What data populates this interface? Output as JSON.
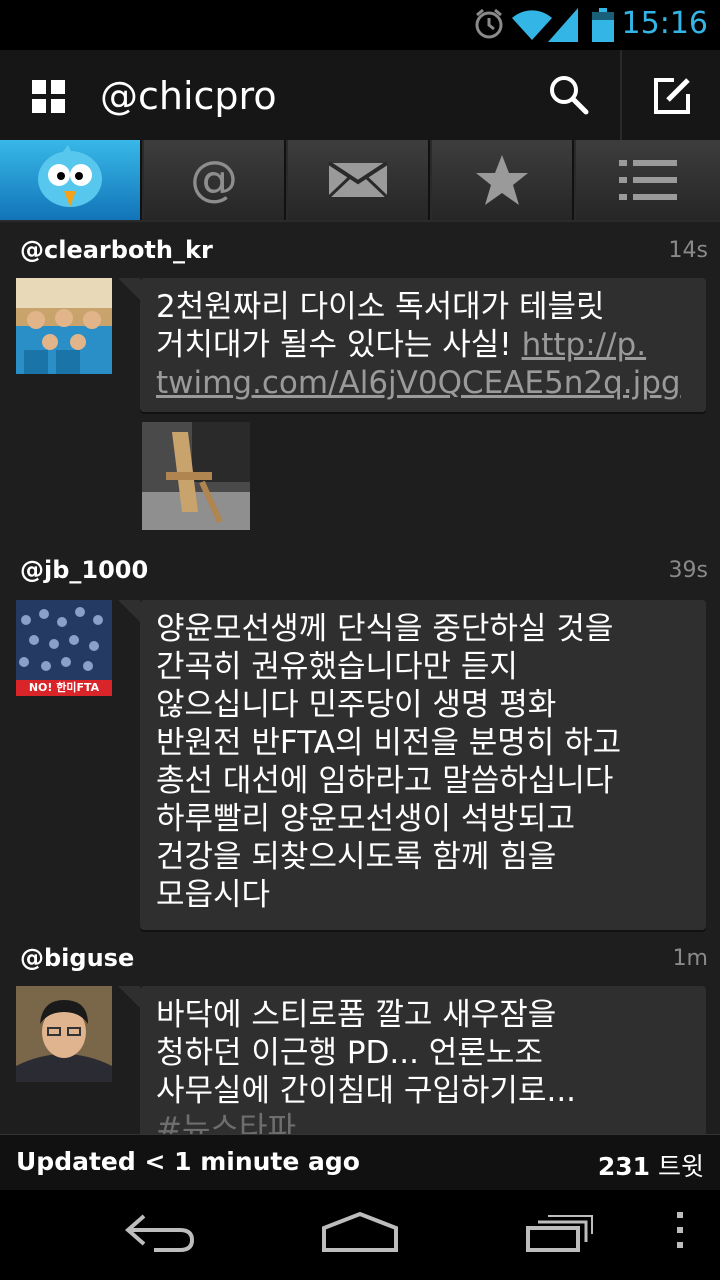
{
  "status_bar": {
    "time": "15:16",
    "icons": [
      "alarm-icon",
      "wifi-icon",
      "cell-signal-icon",
      "battery-icon"
    ],
    "accent_color": "#33b5e5"
  },
  "action_bar": {
    "title": "@chicpro",
    "icons": [
      "app-grid-icon",
      "search-icon",
      "compose-icon"
    ]
  },
  "tabs": [
    {
      "name": "timeline",
      "icon": "bird-icon",
      "active": true
    },
    {
      "name": "mentions",
      "icon": "at-icon",
      "active": false
    },
    {
      "name": "messages",
      "icon": "envelope-icon",
      "active": false
    },
    {
      "name": "favorites",
      "icon": "star-icon",
      "active": false
    },
    {
      "name": "lists",
      "icon": "list-icon",
      "active": false
    }
  ],
  "tweets": [
    {
      "handle": "@clearboth_kr",
      "age": "14s",
      "text_lines": [
        "2천원짜리 다이소 독서대가 테블릿",
        "거치대가 될수 있다는 사실! "
      ],
      "link": "http://p.",
      "link_lines": [
        "twimg.com/Al6jV0QCEAE5n2q.jpg"
      ],
      "has_image": true
    },
    {
      "handle": "@jb_1000",
      "age": "39s",
      "avatar_label": "NO! 한미FTA",
      "text_lines": [
        "양윤모선생께 단식을 중단하실 것을",
        "간곡히 권유했습니다만 듣지",
        "않으십니다 민주당이 생명 평화",
        "반원전 반FTA의 비전을 분명히 하고",
        "총선 대선에 임하라고 말씀하십니다",
        "하루빨리 양윤모선생이 석방되고",
        "건강을 되찾으시도록 함께 힘을",
        "모읍시다"
      ]
    },
    {
      "handle": "@biguse",
      "age": "1m",
      "text_lines": [
        "바닥에 스티로폼 깔고 새우잠을",
        "청하던 이근행 PD... 언론노조",
        "사무실에 간이침대 구입하기로...",
        "#뉴스타파"
      ]
    }
  ],
  "footer": {
    "updated": "Updated < 1 minute ago",
    "count": "231",
    "count_unit": "트윗"
  },
  "nav_bar": {
    "icons": [
      "back-icon",
      "home-icon",
      "recent-apps-icon",
      "overflow-menu-icon"
    ]
  }
}
